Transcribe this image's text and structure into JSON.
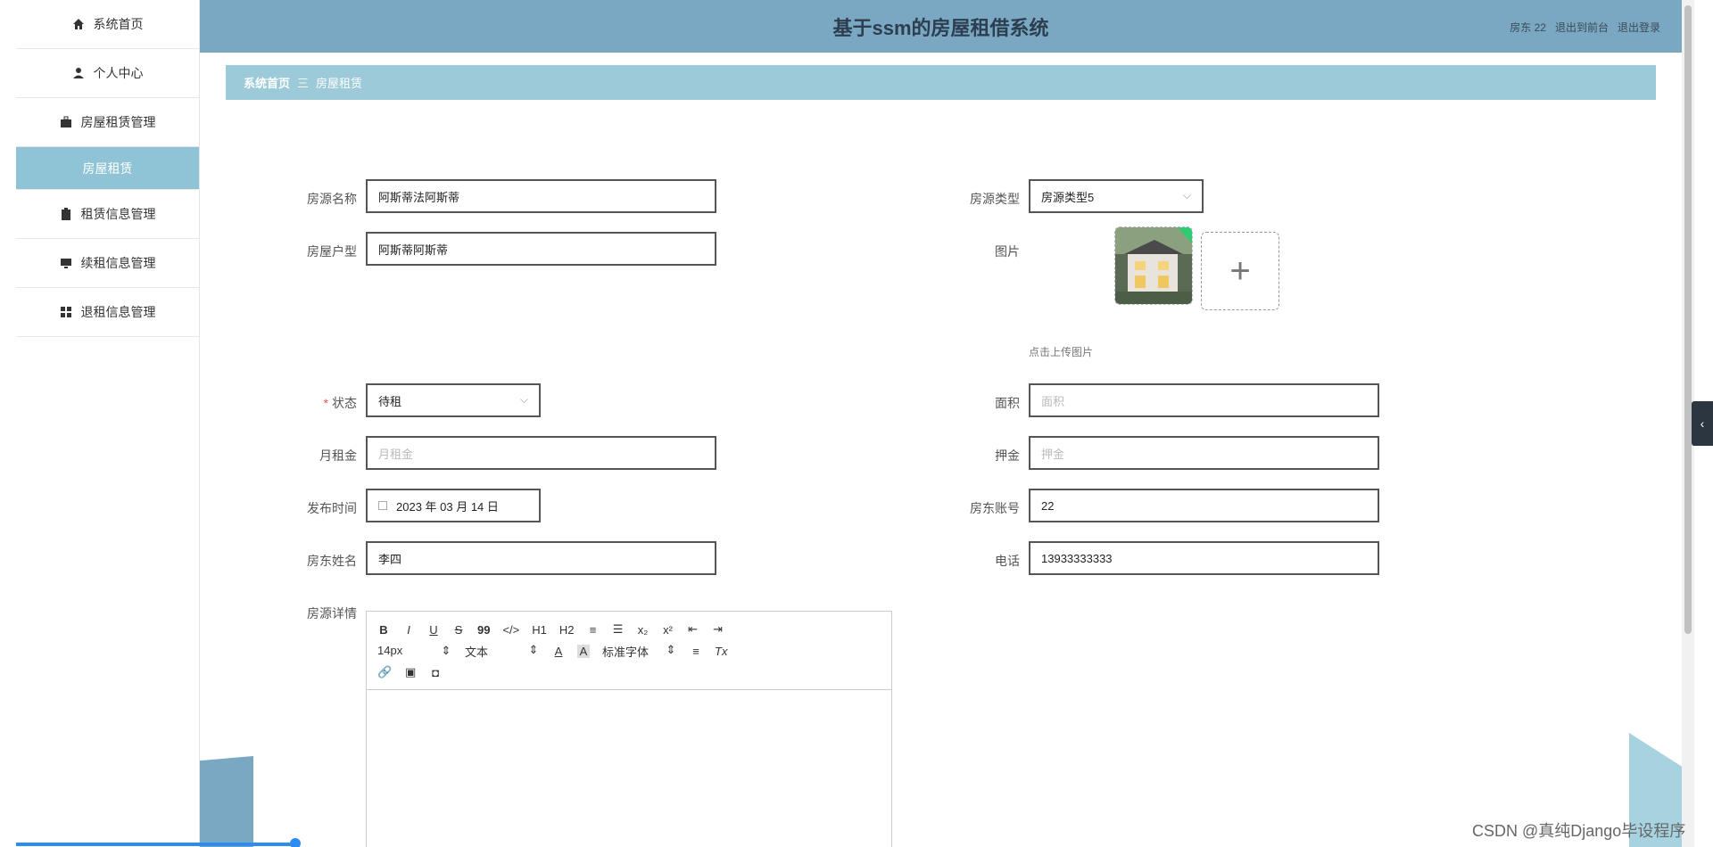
{
  "app": {
    "title": "基于ssm的房屋租借系统"
  },
  "header_links": {
    "user": "房东 22",
    "back_to_front": "退出到前台",
    "logout": "退出登录"
  },
  "sidebar": {
    "items": [
      {
        "label": "系统首页",
        "icon": "home-icon"
      },
      {
        "label": "个人中心",
        "icon": "user-icon"
      },
      {
        "label": "房屋租赁管理",
        "icon": "briefcase-icon"
      },
      {
        "label": "房屋租赁",
        "icon": "",
        "sub": true
      },
      {
        "label": "租赁信息管理",
        "icon": "clipboard-icon"
      },
      {
        "label": "续租信息管理",
        "icon": "monitor-icon"
      },
      {
        "label": "退租信息管理",
        "icon": "grid-icon"
      }
    ]
  },
  "breadcrumb": {
    "home": "系统首页",
    "separator": "三",
    "current": "房屋租赁"
  },
  "form": {
    "name": {
      "label": "房源名称",
      "value": "阿斯蒂法阿斯蒂"
    },
    "type": {
      "label": "房源类型",
      "value": "房源类型5"
    },
    "layout": {
      "label": "房屋户型",
      "value": "阿斯蒂阿斯蒂"
    },
    "image": {
      "label": "图片",
      "upload_tip": "点击上传图片"
    },
    "status": {
      "required_mark": "*",
      "label": "状态",
      "value": "待租"
    },
    "area": {
      "label": "面积",
      "placeholder": "面积"
    },
    "rent": {
      "label": "月租金",
      "placeholder": "月租金"
    },
    "deposit": {
      "label": "押金",
      "placeholder": "押金"
    },
    "publish_time": {
      "label": "发布时间",
      "value": "2023 年 03 月 14 日"
    },
    "landlord_account": {
      "label": "房东账号",
      "value": "22"
    },
    "landlord_name": {
      "label": "房东姓名",
      "value": "李四"
    },
    "phone": {
      "label": "电话",
      "value": "13933333333"
    },
    "details": {
      "label": "房源详情"
    }
  },
  "editor_toolbar": {
    "bold": "B",
    "italic": "I",
    "underline": "U",
    "strike": "S",
    "quote": "99",
    "code": "</>",
    "h1": "H1",
    "h2": "H2",
    "ordered_list": "≡",
    "bullet_list": "☰",
    "subscript": "x₂",
    "superscript": "x²",
    "outdent": "⇤",
    "indent": "⇥",
    "font_size": "14px",
    "text_type": "文本",
    "font_family": "标准字体",
    "align": "≡",
    "clear_format": "Tx"
  },
  "watermark": "CSDN @真纯Django毕设程序"
}
